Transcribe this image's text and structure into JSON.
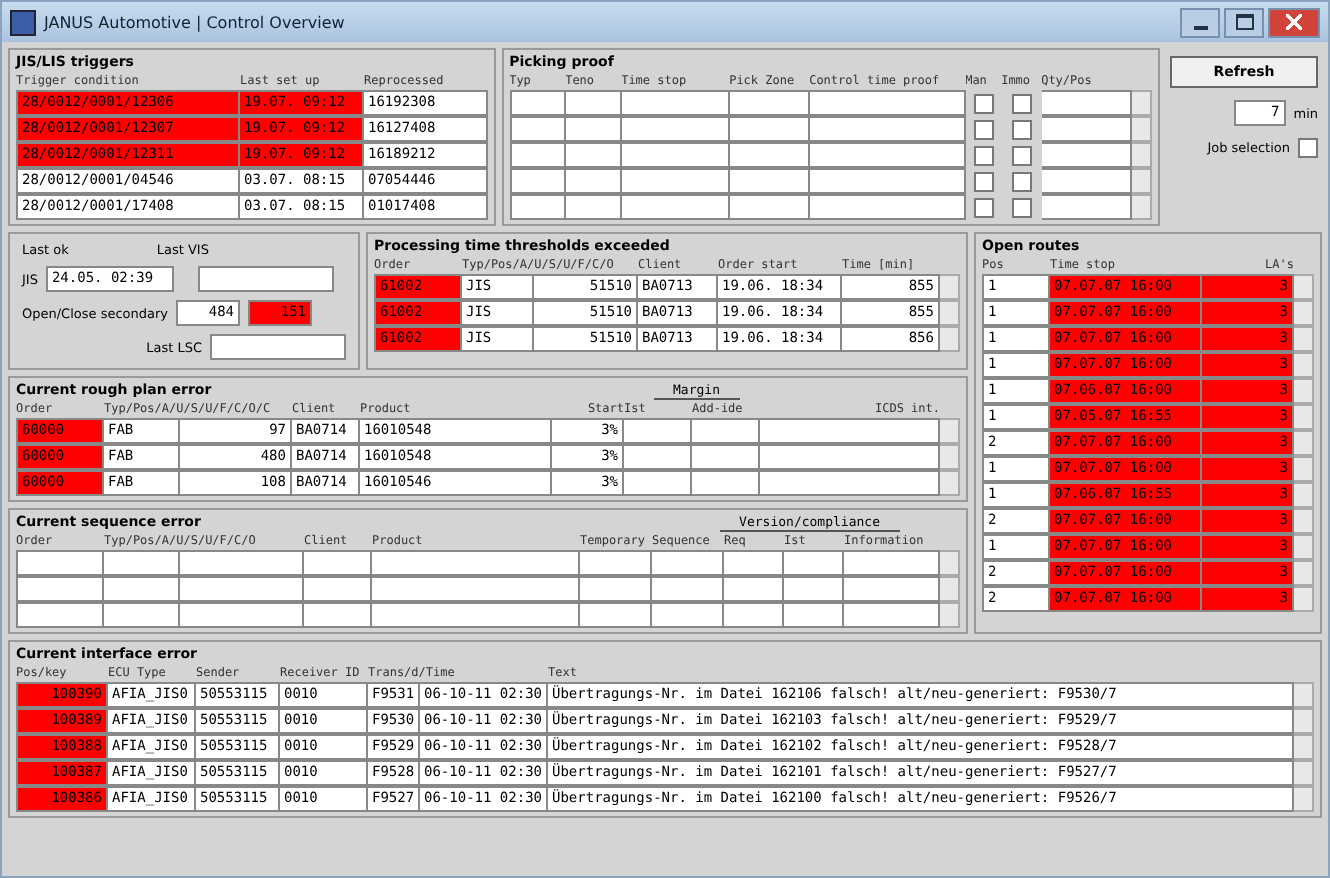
{
  "window": {
    "title": "JANUS Automotive | Control Overview"
  },
  "triggers": {
    "title": "JIS/LIS triggers",
    "columns": [
      "Trigger condition",
      "Last set up",
      "Reprocessed"
    ],
    "rows": [
      {
        "alert": true,
        "cells": [
          "28/0012/0001/12306",
          "19.07. 09:12",
          "16192308"
        ]
      },
      {
        "alert": true,
        "cells": [
          "28/0012/0001/12307",
          "19.07. 09:12",
          "16127408"
        ]
      },
      {
        "alert": true,
        "cells": [
          "28/0012/0001/12311",
          "19.07. 09:12",
          "16189212"
        ]
      },
      {
        "alert": false,
        "cells": [
          "28/0012/0001/04546",
          "03.07. 08:15",
          "07054446"
        ]
      },
      {
        "alert": false,
        "cells": [
          "28/0012/0001/17408",
          "03.07. 08:15",
          "01017408"
        ]
      }
    ]
  },
  "picking": {
    "title": "Picking proof",
    "columns": [
      "Typ",
      "Teno",
      "Time stop",
      "Pick Zone",
      "Control time proof",
      "Man",
      "Immo",
      "Qty/Pos"
    ],
    "rows": [
      {
        "man": false,
        "immo": false
      },
      {
        "man": false,
        "immo": false
      },
      {
        "man": false,
        "immo": false
      },
      {
        "man": false,
        "immo": false
      },
      {
        "man": false,
        "immo": false
      }
    ]
  },
  "controls": {
    "refresh": "Refresh",
    "interval": "7",
    "unit": "min",
    "job_selection": {
      "label": "Job selection",
      "checked": false
    }
  },
  "status": {
    "last_ok_label": "Last ok",
    "last_ok_prefix": "JIS",
    "last_ok_value": "24.05. 02:39",
    "last_vis_label": "Last VIS",
    "open_close_label": "Open/Close secondary",
    "open_value": "484",
    "close_value": "151",
    "close_alert": true,
    "last_lsc_label": "Last LSC"
  },
  "processing": {
    "title": "Processing time thresholds exceeded",
    "columns": [
      "Order",
      "Typ/Pos/A/U/S/U/F/C/O",
      "",
      "Client",
      "Order start",
      "Time [min]"
    ],
    "rows": [
      {
        "alert": true,
        "cells": [
          "61002",
          "JIS",
          "51510",
          "BA0713",
          "19.06. 18:34",
          "855"
        ]
      },
      {
        "alert": true,
        "cells": [
          "61002",
          "JIS",
          "51510",
          "BA0713",
          "19.06. 18:34",
          "855"
        ]
      },
      {
        "alert": true,
        "cells": [
          "61002",
          "JIS",
          "51510",
          "BA0713",
          "19.06. 18:34",
          "856"
        ]
      }
    ]
  },
  "rough": {
    "title": "Current rough plan error",
    "group": "Margin",
    "columns": [
      "Order",
      "Typ/Pos/A/U/S/U/F/C/O/C",
      "",
      "Client",
      "Product",
      "Start",
      "Ist",
      "Add-ide",
      "ICDS int."
    ],
    "rows": [
      {
        "alert": true,
        "cells": [
          "60000",
          "FAB",
          "97",
          "BA0714",
          "16010548",
          "3%",
          "",
          "",
          ""
        ]
      },
      {
        "alert": true,
        "cells": [
          "60000",
          "FAB",
          "480",
          "BA0714",
          "16010548",
          "3%",
          "",
          "",
          ""
        ]
      },
      {
        "alert": true,
        "cells": [
          "60000",
          "FAB",
          "108",
          "BA0714",
          "16010546",
          "3%",
          "",
          "",
          ""
        ]
      }
    ]
  },
  "sequence": {
    "title": "Current sequence error",
    "group": "Version/compliance",
    "columns": [
      "Order",
      "Typ/Pos/A/U/S/U/F/C/O",
      "",
      "Client",
      "Product",
      "Temporary",
      "Sequence",
      "Req",
      "Ist",
      "Information"
    ]
  },
  "routes": {
    "title": "Open routes",
    "columns": [
      "Pos",
      "Time stop",
      "LA's"
    ],
    "rows": [
      {
        "alert": true,
        "cells": [
          "1",
          "07.07.07 16:00",
          "3"
        ]
      },
      {
        "alert": true,
        "cells": [
          "1",
          "07.07.07 16:00",
          "3"
        ]
      },
      {
        "alert": true,
        "cells": [
          "1",
          "07.07.07 16:00",
          "3"
        ]
      },
      {
        "alert": true,
        "cells": [
          "1",
          "07.07.07 16:00",
          "3"
        ]
      },
      {
        "alert": true,
        "cells": [
          "1",
          "07.06.07 16:00",
          "3"
        ]
      },
      {
        "alert": true,
        "cells": [
          "1",
          "07.05.07 16:55",
          "3"
        ]
      },
      {
        "alert": true,
        "cells": [
          "2",
          "07.07.07 16:00",
          "3"
        ]
      },
      {
        "alert": true,
        "cells": [
          "1",
          "07.07.07 16:00",
          "3"
        ]
      },
      {
        "alert": true,
        "cells": [
          "1",
          "07.06.07 16:55",
          "3"
        ]
      },
      {
        "alert": true,
        "cells": [
          "2",
          "07.07.07 16:00",
          "3"
        ]
      },
      {
        "alert": true,
        "cells": [
          "1",
          "07.07.07 16:00",
          "3"
        ]
      },
      {
        "alert": true,
        "cells": [
          "2",
          "07.07.07 16:00",
          "3"
        ]
      },
      {
        "alert": true,
        "cells": [
          "2",
          "07.07.07 16:00",
          "3"
        ]
      }
    ]
  },
  "interface": {
    "title": "Current interface error",
    "columns": [
      "Pos/key",
      "ECU Type",
      "Sender",
      "Receiver ID",
      "Trans/d/Time",
      "",
      "Text"
    ],
    "rows": [
      {
        "alert": true,
        "cells": [
          "100390",
          "AFIA_JIS0",
          "50553115",
          "0010",
          "F9531",
          "06-10-11 02:30",
          "Übertragungs-Nr. im Datei 162106 falsch! alt/neu-generiert: F9530/7"
        ]
      },
      {
        "alert": true,
        "cells": [
          "100389",
          "AFIA_JIS0",
          "50553115",
          "0010",
          "F9530",
          "06-10-11 02:30",
          "Übertragungs-Nr. im Datei 162103 falsch! alt/neu-generiert: F9529/7"
        ]
      },
      {
        "alert": true,
        "cells": [
          "100388",
          "AFIA_JIS0",
          "50553115",
          "0010",
          "F9529",
          "06-10-11 02:30",
          "Übertragungs-Nr. im Datei 162102 falsch! alt/neu-generiert: F9528/7"
        ]
      },
      {
        "alert": true,
        "cells": [
          "100387",
          "AFIA_JIS0",
          "50553115",
          "0010",
          "F9528",
          "06-10-11 02:30",
          "Übertragungs-Nr. im Datei 162101 falsch! alt/neu-generiert: F9527/7"
        ]
      },
      {
        "alert": true,
        "cells": [
          "100386",
          "AFIA_JIS0",
          "50553115",
          "0010",
          "F9527",
          "06-10-11 02:30",
          "Übertragungs-Nr. im Datei 162100 falsch! alt/neu-generiert: F9526/7"
        ]
      }
    ]
  }
}
